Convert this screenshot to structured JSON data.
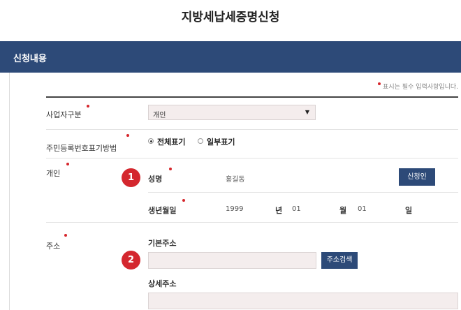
{
  "page_title": "지방세납세증명신청",
  "section": {
    "title": "신청내용"
  },
  "required_note": "표시는 필수 입력사항입니다.",
  "fields": {
    "business_type": {
      "label": "사업자구분",
      "value": "개인"
    },
    "rrn_display": {
      "label": "주민등록번호표기방법",
      "options": [
        {
          "label": "전체표기",
          "checked": true
        },
        {
          "label": "일부표기",
          "checked": false
        }
      ]
    },
    "individual": {
      "label": "개인",
      "badge": "1",
      "name_label": "성명",
      "name_value": "홍길동",
      "applicant_button": "신청인",
      "birth_label": "생년월일",
      "birth_year": "1999",
      "year_unit": "년",
      "birth_month": "01",
      "month_unit": "월",
      "birth_day": "01",
      "day_unit": "일"
    },
    "address": {
      "label": "주소",
      "badge": "2",
      "basic_label": "기본주소",
      "basic_value": "",
      "search_button": "주소검색",
      "detail_label": "상세주소",
      "detail_value": ""
    }
  },
  "colors": {
    "header_bar": "#2d4a78",
    "required": "#d6262c",
    "badge": "#d4272e",
    "input_bg": "#f4eded"
  }
}
